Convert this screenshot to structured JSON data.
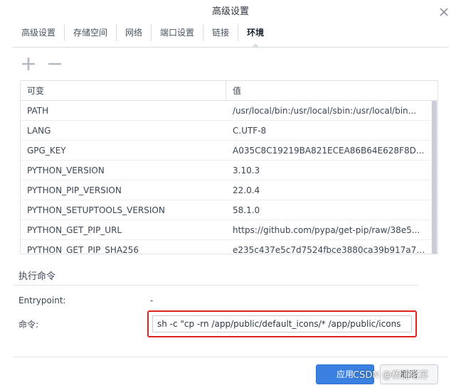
{
  "dialog": {
    "title": "高级设置"
  },
  "tabs": [
    {
      "label": "高级设置"
    },
    {
      "label": "存储空间"
    },
    {
      "label": "网络"
    },
    {
      "label": "端口设置"
    },
    {
      "label": "链接"
    },
    {
      "label": "环境",
      "active": true
    }
  ],
  "toolbar": {
    "add_icon": "plus-icon",
    "remove_icon": "minus-icon"
  },
  "env_table": {
    "headers": [
      "可变",
      "值"
    ],
    "rows": [
      [
        "PATH",
        "/usr/local/bin:/usr/local/sbin:/usr/local/bin..."
      ],
      [
        "LANG",
        "C.UTF-8"
      ],
      [
        "GPG_KEY",
        "A035C8C19219BA821ECEA86B64E628F8D..."
      ],
      [
        "PYTHON_VERSION",
        "3.10.3"
      ],
      [
        "PYTHON_PIP_VERSION",
        "22.0.4"
      ],
      [
        "PYTHON_SETUPTOOLS_VERSION",
        "58.1.0"
      ],
      [
        "PYTHON_GET_PIP_URL",
        "https://github.com/pypa/get-pip/raw/38e5..."
      ],
      [
        "PYTHON_GET_PIP_SHA256",
        "e235c437e5c7d7524fbce3880ca39b917a73..."
      ]
    ]
  },
  "execute": {
    "section_title": "执行命令",
    "entrypoint_label": "Entrypoint:",
    "entrypoint_value": "-",
    "command_label": "命令:",
    "command_value": "sh -c \"cp -rn /app/public/default_icons/* /app/public/icons"
  },
  "footer": {
    "apply_label": "应用",
    "cancel_label": "取消",
    "watermark": "CSDN @杨浦老苏"
  },
  "colors": {
    "accent": "#3a80e0",
    "highlight_border": "#e0231f"
  }
}
